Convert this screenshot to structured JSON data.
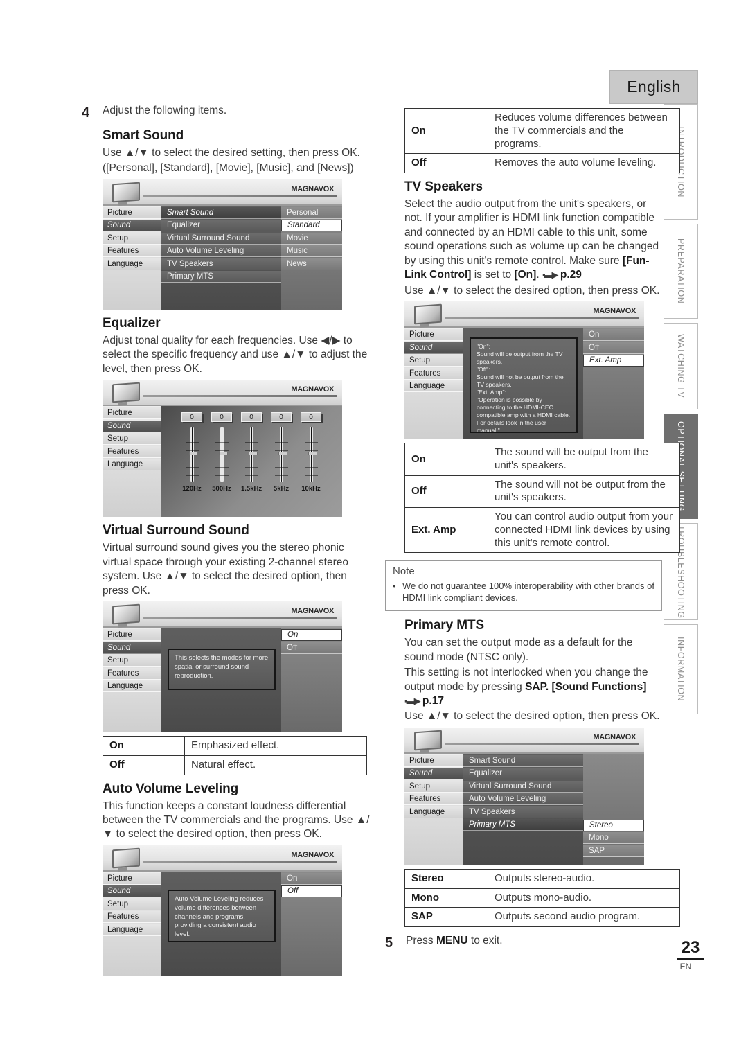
{
  "page": {
    "language_banner": "English",
    "number": "23",
    "locale_code": "EN"
  },
  "side_tabs": [
    {
      "label": "INTRODUCTION",
      "active": false
    },
    {
      "label": "PREPARATION",
      "active": false
    },
    {
      "label": "WATCHING TV",
      "active": false
    },
    {
      "label": "OPTIONAL SETTING",
      "active": true
    },
    {
      "label": "TROUBLESHOOTING",
      "active": false
    },
    {
      "label": "INFORMATION",
      "active": false
    }
  ],
  "steps": {
    "four_num": "4",
    "four_text": "Adjust the following items.",
    "five_num": "5",
    "five_text_pre": "Press ",
    "five_text_key": "MENU",
    "five_text_post": " to exit."
  },
  "osd_common": {
    "brand": "MAGNAVOX",
    "left_menu": [
      "Picture",
      "Sound",
      "Setup",
      "Features",
      "Language"
    ],
    "left_selected": "Sound"
  },
  "smart_sound": {
    "heading": "Smart Sound",
    "body_line1": "Use ▲/▼ to select the desired setting, then press OK.",
    "body_line2": "([Personal], [Standard], [Movie], [Music], and [News])",
    "osd": {
      "middle_items": [
        "Smart Sound",
        "Equalizer",
        "Virtual Surround Sound",
        "Auto Volume Leveling",
        "TV Speakers",
        "Primary MTS"
      ],
      "middle_current": "Smart Sound",
      "right_items": [
        "Personal",
        "Standard",
        "Movie",
        "Music",
        "News"
      ],
      "right_highlight": "Standard"
    }
  },
  "equalizer": {
    "heading": "Equalizer",
    "body": "Adjust tonal quality for each frequencies. Use ◀/▶ to select the specific frequency and use ▲/▼ to adjust the level, then press OK.",
    "osd": {
      "values": [
        "0",
        "0",
        "0",
        "0",
        "0"
      ],
      "bands": [
        "120Hz",
        "500Hz",
        "1.5kHz",
        "5kHz",
        "10kHz"
      ]
    }
  },
  "virtual_surround": {
    "heading": "Virtual Surround Sound",
    "body": "Virtual surround sound gives you the stereo phonic virtual space through your existing 2-channel stereo system. Use ▲/▼ to select the desired option, then press OK.",
    "osd": {
      "help_text": "This selects the modes for more spatial or surround sound reproduction.",
      "right_items": [
        "On",
        "Off"
      ],
      "right_highlight": "On"
    },
    "table": [
      {
        "key": "On",
        "desc": "Emphasized effect."
      },
      {
        "key": "Off",
        "desc": "Natural effect."
      }
    ]
  },
  "auto_volume": {
    "heading": "Auto Volume Leveling",
    "body": "This function keeps a constant loudness differential between the TV commercials and the programs. Use ▲/▼ to select the desired option, then press OK.",
    "osd": {
      "help_text": "Auto Volume Leveling reduces volume differences between channels and programs, providing a consistent audio level.",
      "right_items": [
        "On",
        "Off"
      ],
      "right_highlight": "Off"
    },
    "table": [
      {
        "key": "On",
        "desc": "Reduces volume differences between the TV commercials and the programs."
      },
      {
        "key": "Off",
        "desc": "Removes the auto volume leveling."
      }
    ]
  },
  "tv_speakers": {
    "heading": "TV Speakers",
    "body_p1": "Select the audio output from the unit's speakers, or not. If your amplifier is HDMI link function compatible and connected by an HDMI cable to this unit, some sound operations such as volume up can be changed by using this unit's remote control. Make sure ",
    "body_bold1": "[Fun-Link Control]",
    "body_p2": " is set to ",
    "body_bold2": "[On]",
    "body_p3": ". ",
    "body_ref": "p.29",
    "body_p4": "Use ▲/▼ to select the desired option, then press OK.",
    "osd": {
      "help_text": "\"On\":\nSound will be output from the TV speakers.\n\"Off\":\nSound will not be output from the TV speakers.\n\"Ext. Amp\":\n\"Operation is possible by connecting to the HDMI-CEC compatible amp with a HDMI cable.\nFor details look in the user manual.\"",
      "right_items": [
        "On",
        "Off",
        "Ext. Amp"
      ],
      "right_highlight": "Ext. Amp"
    },
    "table": [
      {
        "key": "On",
        "desc": "The sound will be output from the unit's speakers."
      },
      {
        "key": "Off",
        "desc": "The sound will not be output from the unit's speakers."
      },
      {
        "key": "Ext. Amp",
        "desc": "You can control audio output from your connected HDMI link devices by using this unit's remote control."
      }
    ]
  },
  "note": {
    "title": "Note",
    "bullet": "•",
    "text": "We do not guarantee 100% interoperability with other brands of HDMI link compliant devices."
  },
  "primary_mts": {
    "heading": "Primary MTS",
    "body_p1": "You can set the output mode as a default for the sound mode (NTSC only).",
    "body_p2": "This setting is not interlocked when you change the output mode by pressing ",
    "body_bold1": "SAP. [Sound Functions]",
    "body_ref": "p.17",
    "body_p3": "Use ▲/▼ to select the desired option, then press OK.",
    "osd": {
      "middle_items": [
        "Smart Sound",
        "Equalizer",
        "Virtual Surround Sound",
        "Auto Volume Leveling",
        "TV Speakers",
        "Primary MTS"
      ],
      "middle_current": "Primary MTS",
      "right_items": [
        "Stereo",
        "Mono",
        "SAP"
      ],
      "right_highlight": "Stereo"
    },
    "table": [
      {
        "key": "Stereo",
        "desc": "Outputs stereo-audio."
      },
      {
        "key": "Mono",
        "desc": "Outputs mono-audio."
      },
      {
        "key": "SAP",
        "desc": "Outputs second audio program."
      }
    ]
  }
}
